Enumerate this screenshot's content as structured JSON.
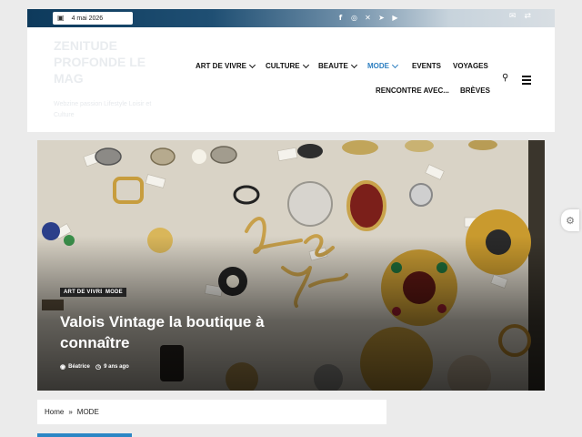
{
  "topbar": {
    "date": "4 mai 2026",
    "social_icons": [
      "facebook-icon",
      "instagram-icon",
      "x-icon",
      "telegram-icon",
      "youtube-icon"
    ],
    "right_icons": [
      "mail-icon",
      "shuffle-icon"
    ]
  },
  "header": {
    "site_title": "ZENITUDE PROFONDE LE MAG",
    "tagline": "Webzine passion Lifestyle Loisir et Culture"
  },
  "nav": {
    "items": [
      {
        "label": "ART DE VIVRE",
        "dropdown": true
      },
      {
        "label": "CULTURE",
        "dropdown": true
      },
      {
        "label": "BEAUTE",
        "dropdown": true
      },
      {
        "label": "MODE",
        "dropdown": true,
        "active": true
      },
      {
        "label": "EVENTS",
        "dropdown": false
      },
      {
        "label": "VOYAGES",
        "dropdown": false
      },
      {
        "label": "RENCONTRE AVEC...",
        "dropdown": false
      },
      {
        "label": "BRÈVES",
        "dropdown": false
      }
    ]
  },
  "hero": {
    "categories": [
      "ART DE VIVRE",
      "MODE"
    ],
    "title": "Valois Vintage la boutique à connaître",
    "author": "Béatrice",
    "time_ago": "9 ans ago",
    "image_alt": "Bijoux vintage : broches et bagues Chanel"
  },
  "breadcrumb": {
    "home": "Home",
    "separator": "»",
    "current": "MODE"
  },
  "colors": {
    "accent": "#2d7fc1",
    "topbar_dark": "#0d3a5c"
  }
}
